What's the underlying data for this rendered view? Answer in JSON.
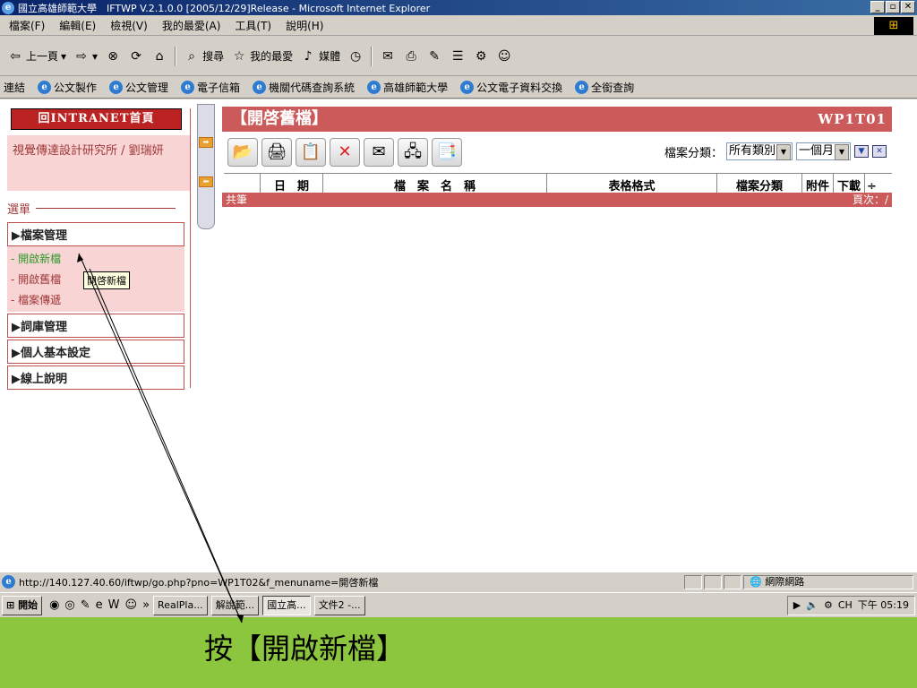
{
  "window": {
    "title": "國立高雄師範大學　IFTWP V.2.1.0.0 [2005/12/29]Release - Microsoft Internet Explorer"
  },
  "menubar": [
    "檔案(F)",
    "編輯(E)",
    "檢視(V)",
    "我的最愛(A)",
    "工具(T)",
    "說明(H)"
  ],
  "toolbar": {
    "back": "上一頁",
    "search": "搜尋",
    "favorites": "我的最愛",
    "media": "媒體"
  },
  "links": {
    "label": "連結",
    "items": [
      "公文製作",
      "公文管理",
      "電子信箱",
      "機關代碼查詢系統",
      "高雄師範大學",
      "公文電子資料交換",
      "全銜查詢"
    ]
  },
  "sidebar": {
    "intranet": "回INTRANET首頁",
    "user": "視覺傳達設計研究所 / 劉瑞妍",
    "menu_label": "選單",
    "groups": [
      "▶檔案管理",
      "▶詞庫管理",
      "▶個人基本設定",
      "▶線上說明"
    ],
    "file_items": [
      "- 開啟新檔",
      "- 開啟舊檔",
      "- 檔案傳遞"
    ]
  },
  "main": {
    "title": "【開啓舊檔】",
    "code": "WP1T01",
    "filter_label": "檔案分類：",
    "filter_category": "所有類別",
    "filter_period": "一個月",
    "columns": [
      "日　期",
      "檔　案　名　稱",
      "表格格式",
      "檔案分類",
      "附件",
      "下載"
    ],
    "footer_left": "共筆",
    "footer_right": "頁次：/"
  },
  "tooltip": "開啓新檔",
  "statusbar": {
    "url": "http://140.127.40.60/iftwp/go.php?pno=WP1T02&f_menuname=開啓新檔",
    "zone": "網際網路"
  },
  "taskbar": {
    "start": "開始",
    "tasks": [
      "RealPla...",
      "解說範...",
      "國立高...",
      "文件2 -..."
    ],
    "time": "下午 05:19"
  },
  "caption": "按【開啟新檔】",
  "colors": {
    "accent": "#cc5a5a",
    "caption_bg": "#8cc63e",
    "active_item": "#2a9a2a"
  }
}
